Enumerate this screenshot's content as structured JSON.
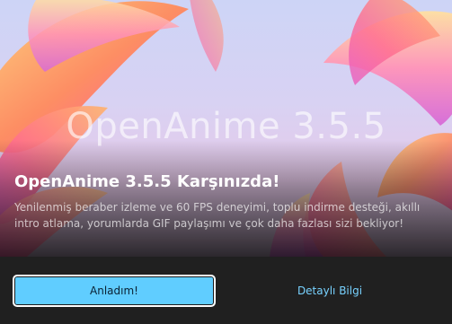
{
  "hero": {
    "logo_text": "OpenAnime 3.5.5"
  },
  "content": {
    "title": "OpenAnime 3.5.5 Karşınızda!",
    "description": "Yenilenmiş beraber izleme ve 60 FPS deneyimi, toplu indirme desteği, akıllı intro atlama, yorumlarda GIF paylaşımı ve çok daha fazlası sizi bekliyor!"
  },
  "actions": {
    "primary_label": "Anladım!",
    "secondary_label": "Detaylı Bilgi"
  },
  "colors": {
    "accent": "#60cdff",
    "link": "#78d2ff",
    "background": "#202020"
  }
}
